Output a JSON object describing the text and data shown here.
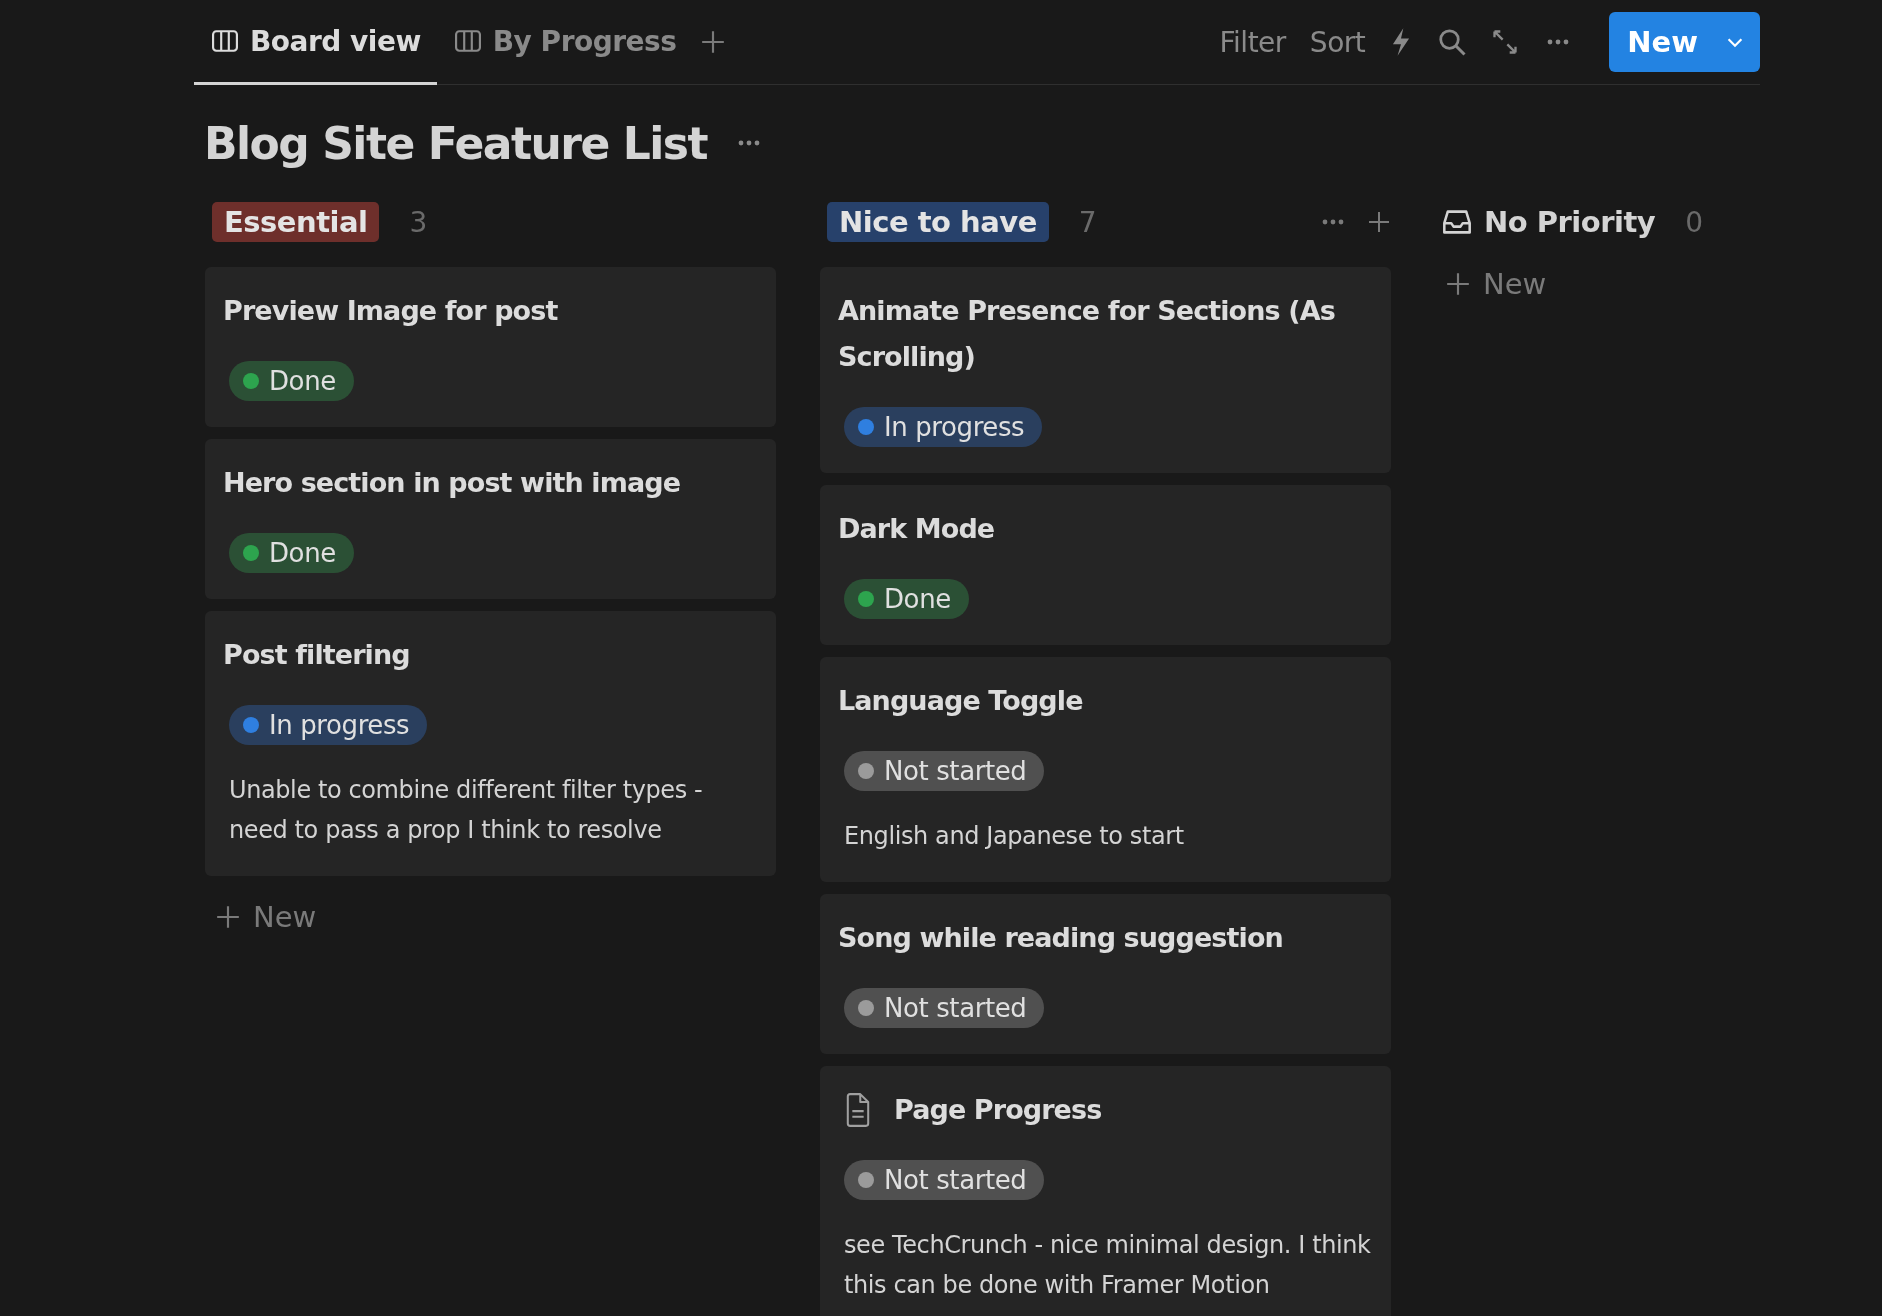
{
  "tabs": [
    {
      "label": "Board view",
      "selected": true
    },
    {
      "label": "By Progress",
      "selected": false
    }
  ],
  "toolbar": {
    "filter": "Filter",
    "sort": "Sort",
    "new_button": "New"
  },
  "title": "Blog Site Feature List",
  "columns": [
    {
      "kind": "tag",
      "name": "Essential",
      "color": "#6e2f2b",
      "count": "3",
      "show_actions": false,
      "new_label": "New",
      "cards": [
        {
          "title": "Preview Image for post",
          "has_icon": false,
          "status": {
            "kind": "done",
            "label": "Done",
            "color": "#2da44e"
          }
        },
        {
          "title": "Hero section in post with image",
          "has_icon": false,
          "status": {
            "kind": "done",
            "label": "Done",
            "color": "#2da44e"
          }
        },
        {
          "title": "Post filtering",
          "has_icon": false,
          "status": {
            "kind": "in_progress",
            "label": "In progress",
            "color": "#2f7fe0"
          },
          "note": "Unable to combine different filter types - need to pass a prop I think to resolve"
        }
      ]
    },
    {
      "kind": "tag",
      "name": "Nice to have",
      "color": "#27416b",
      "count": "7",
      "show_actions": true,
      "cards": [
        {
          "title": "Animate Presence for Sections (As Scrolling)",
          "has_icon": false,
          "status": {
            "kind": "in_progress",
            "label": "In progress",
            "color": "#2f7fe0"
          }
        },
        {
          "title": "Dark Mode",
          "has_icon": false,
          "status": {
            "kind": "done",
            "label": "Done",
            "color": "#2da44e"
          }
        },
        {
          "title": "Language Toggle",
          "has_icon": false,
          "status": {
            "kind": "not_started",
            "label": "Not started",
            "color": "#9b9b9b"
          },
          "note": "English and Japanese to start"
        },
        {
          "title": "Song while reading suggestion",
          "has_icon": false,
          "status": {
            "kind": "not_started",
            "label": "Not started",
            "color": "#9b9b9b"
          }
        },
        {
          "title": "Page Progress",
          "has_icon": true,
          "status": {
            "kind": "not_started",
            "label": "Not started",
            "color": "#9b9b9b"
          },
          "note": "see TechCrunch - nice minimal design. I think this can be done with Framer Motion"
        }
      ]
    },
    {
      "kind": "plain",
      "name": "No Priority",
      "count": "0",
      "show_actions": false,
      "new_label": "New"
    }
  ]
}
